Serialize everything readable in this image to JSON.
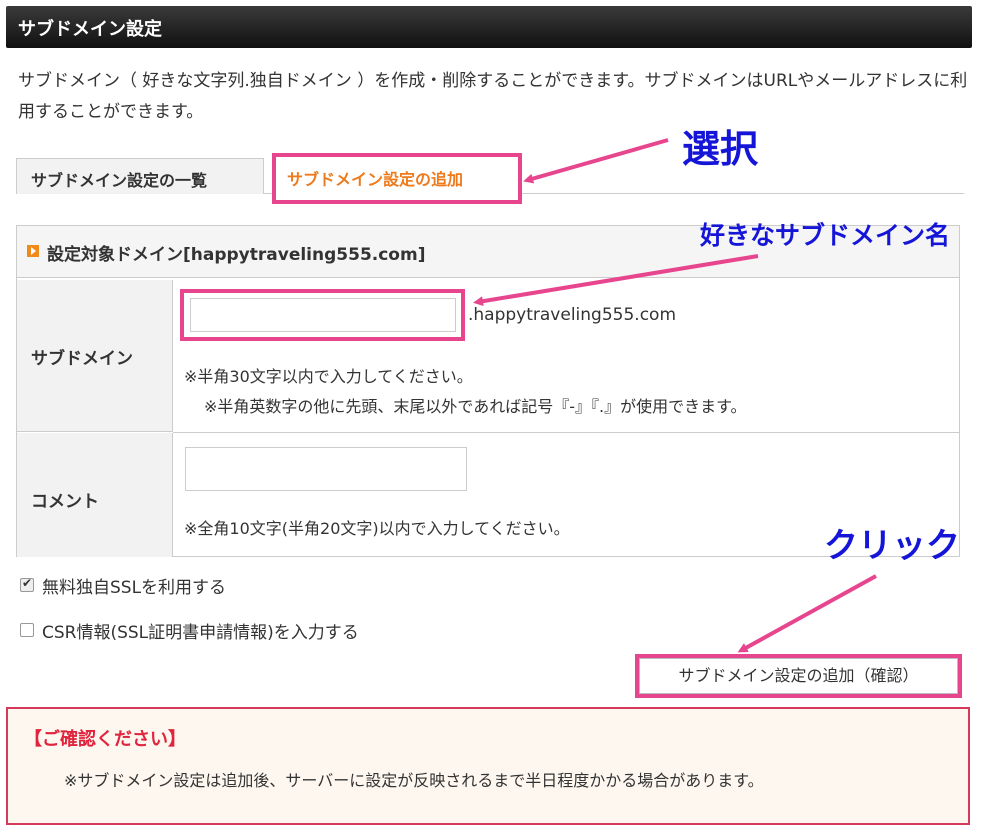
{
  "header": {
    "title": "サブドメイン設定"
  },
  "intro": {
    "text": "サブドメイン（ 好きな文字列.独自ドメイン ）を作成・削除することができます。サブドメインはURLやメールアドレスに利用することができます。"
  },
  "tabs": [
    {
      "label": "サブドメイン設定の一覧"
    },
    {
      "label": "サブドメイン設定の追加"
    }
  ],
  "panel": {
    "heading": "設定対象ドメイン[happytraveling555.com]",
    "subdomain_label": "サブドメイン",
    "subdomain_value": "",
    "domain_suffix": ".happytraveling555.com",
    "subdomain_note1": "※半角30文字以内で入力してください。",
    "subdomain_note2": "※半角英数字の他に先頭、末尾以外であれば記号『-』『.』が使用できます。",
    "comment_label": "コメント",
    "comment_value": "",
    "comment_note": "※全角10文字(半角20文字)以内で入力してください。"
  },
  "options": {
    "ssl_label": "無料独自SSLを利用する",
    "ssl_checked": true,
    "csr_label": "CSR情報(SSL証明書申請情報)を入力する",
    "csr_checked": false
  },
  "confirm_button": {
    "label": "サブドメイン設定の追加（確認）"
  },
  "notice": {
    "title": "【ご確認ください】",
    "text": "※サブドメイン設定は追加後、サーバーに設定が反映されるまで半日程度かかる場合があります。"
  },
  "annotations": {
    "select": "選択",
    "subdomain_name": "好きなサブドメイン名",
    "click": "クリック"
  },
  "colors": {
    "highlight_pink": "#e8458f",
    "annotation_blue": "#1515d8",
    "tab_active_orange": "#ee7a1b",
    "notice_red": "#e0243d"
  }
}
